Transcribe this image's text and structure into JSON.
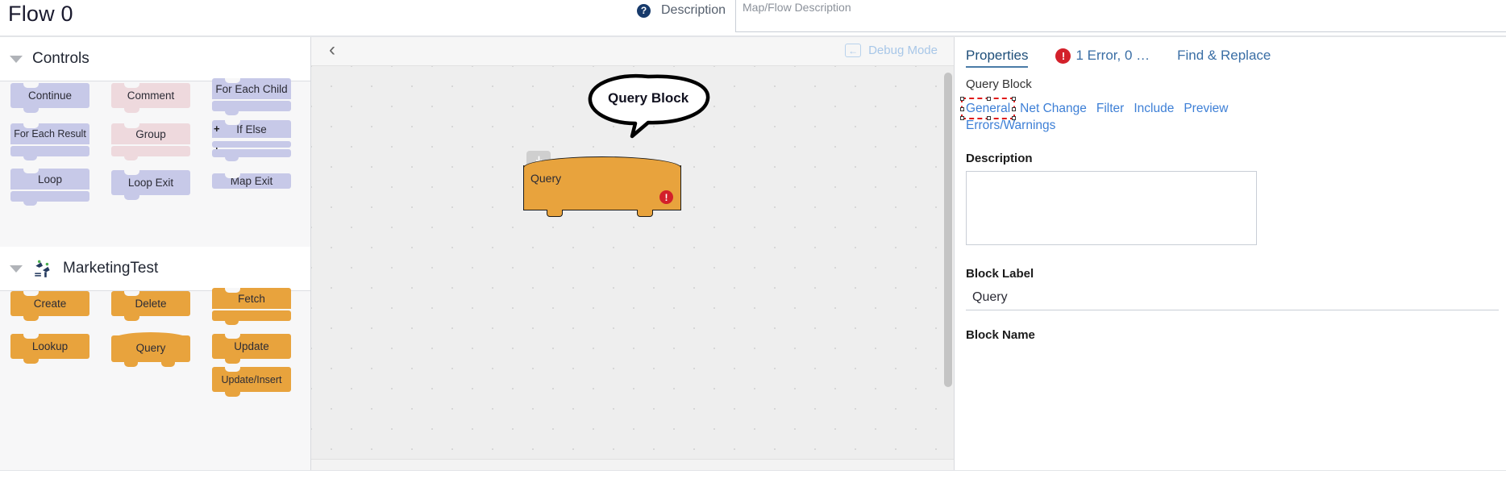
{
  "header": {
    "flow_title": "Flow 0",
    "help_icon": "question-mark-icon",
    "description_label": "Description",
    "description_placeholder": "Map/Flow Description",
    "description_value": ""
  },
  "palette": {
    "sections": [
      {
        "title": "Controls",
        "icon": null,
        "blocks": [
          {
            "label": "Continue",
            "color": "lav",
            "shape": "simple"
          },
          {
            "label": "Comment",
            "color": "pink",
            "shape": "simple"
          },
          {
            "label": "For Each Child",
            "color": "lav",
            "shape": "container"
          },
          {
            "label": "For Each Result",
            "color": "lav",
            "shape": "container"
          },
          {
            "label": "Group",
            "color": "pink",
            "shape": "container"
          },
          {
            "label": "If Else",
            "color": "lav",
            "shape": "container2"
          },
          {
            "label": "Loop",
            "color": "lav",
            "shape": "container"
          },
          {
            "label": "Loop Exit",
            "color": "lav",
            "shape": "simple"
          },
          {
            "label": "Map Exit",
            "color": "lav",
            "shape": "flat"
          }
        ]
      },
      {
        "title": "MarketingTest",
        "icon": "marketing-logo-icon",
        "blocks": [
          {
            "label": "Create",
            "color": "orange",
            "shape": "simple"
          },
          {
            "label": "Delete",
            "color": "orange",
            "shape": "simple"
          },
          {
            "label": "Fetch",
            "color": "orange",
            "shape": "container"
          },
          {
            "label": "Lookup",
            "color": "orange",
            "shape": "simple"
          },
          {
            "label": "Query",
            "color": "orange",
            "shape": "query"
          },
          {
            "label": "Update",
            "color": "orange",
            "shape": "simple"
          },
          {
            "label": "Update/Insert",
            "color": "orange",
            "shape": "simple"
          }
        ]
      }
    ]
  },
  "canvas": {
    "collapse_icon": "chevron-left-icon",
    "debug_mode_label": "Debug Mode",
    "debug_mode_icon": "arrow-left-icon",
    "block": {
      "label": "Query",
      "collapse_tab_icon": "arrow-down-icon",
      "error_icon": "error-exclamation-icon"
    },
    "callout_text": "Query Block"
  },
  "properties": {
    "tabs": [
      {
        "label": "Properties",
        "active": true,
        "icon": null
      },
      {
        "label": "1 Error, 0 …",
        "active": false,
        "icon": "error-exclamation-icon"
      },
      {
        "label": "Find & Replace",
        "active": false,
        "icon": null
      }
    ],
    "block_kind": "Query Block",
    "subtabs": [
      {
        "label": "General",
        "selected": true
      },
      {
        "label": "Net Change",
        "selected": false
      },
      {
        "label": "Filter",
        "selected": false
      },
      {
        "label": "Include",
        "selected": false
      },
      {
        "label": "Preview",
        "selected": false
      },
      {
        "label": "Errors/Warnings",
        "selected": false
      }
    ],
    "description_label": "Description",
    "description_value": "",
    "block_label_label": "Block Label",
    "block_label_value": "Query",
    "block_name_label": "Block Name"
  },
  "colors": {
    "orange_block": "#e8a33d",
    "lavender_block": "#c7c9e8",
    "pink_block": "#eed9dd",
    "error_red": "#d3202a",
    "link_blue": "#3d7fd6",
    "tab_blue": "#3a6ea5",
    "help_navy": "#173a6b"
  }
}
